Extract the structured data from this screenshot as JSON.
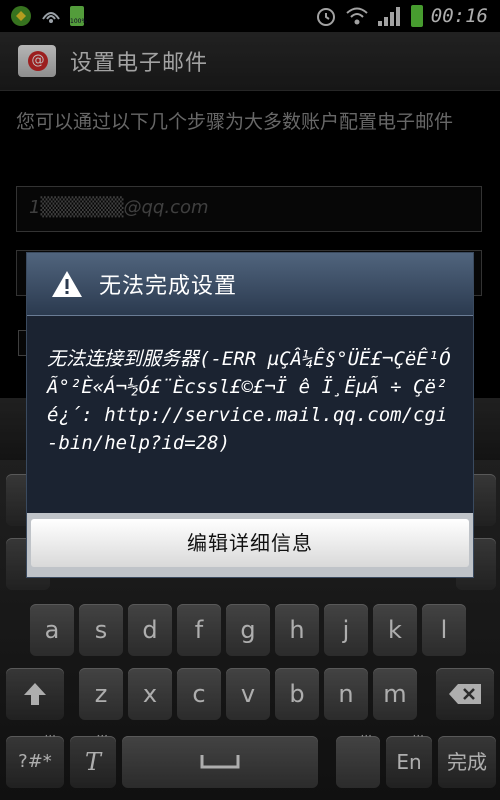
{
  "status_bar": {
    "time": "00:16",
    "battery_small_label": "100%",
    "icons": [
      "shield-icon",
      "radar-icon",
      "battery-small-icon",
      "alarm-icon",
      "wifi-icon",
      "signal-icon",
      "battery-icon"
    ]
  },
  "header": {
    "icon": "email-icon",
    "icon_glyph": "@",
    "title": "设置电子邮件"
  },
  "background": {
    "description": "您可以通过以下几个步骤为大多数账户配置电子邮件",
    "email_value": "1▒▒▒▒▒▒@qq.com"
  },
  "dialog": {
    "title": "无法完成设置",
    "icon": "warning-icon",
    "message": "无法连接到服务器(-ERR µÇÂ¼Ê§°ÜË£¬ÇëÊ¹ÓÃ°²È«Á¬½Ó£¨Ècssl£©£¬Ï ê Ï¸ËµÃ ÷ Çë² é¿´: http://service.mail.qq.com/cgi-bin/help?id=28)",
    "button_label": "编辑详细信息"
  },
  "keyboard": {
    "row3": [
      "a",
      "s",
      "d",
      "f",
      "g",
      "h",
      "j",
      "k",
      "l"
    ],
    "row4": [
      "z",
      "x",
      "c",
      "v",
      "b",
      "n",
      "m"
    ],
    "symbols_label": "?#*",
    "lang_label": "En",
    "done_label": "完成",
    "shift_icon": "shift-icon",
    "delete_icon": "backspace-icon",
    "space_icon": "space-icon",
    "text_tool_label": "T"
  }
}
